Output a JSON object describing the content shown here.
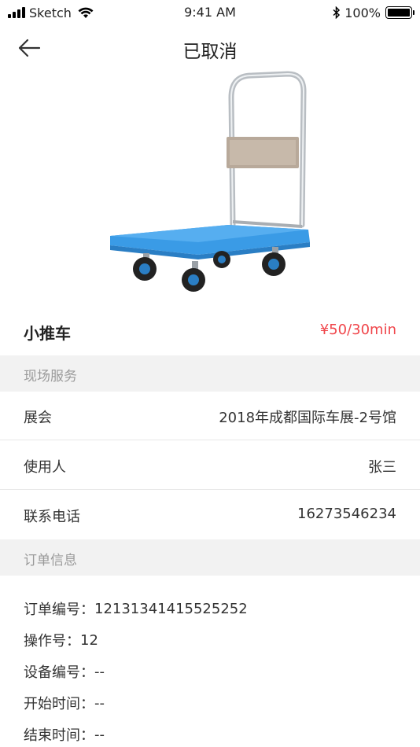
{
  "status_bar": {
    "carrier": "Sketch",
    "time": "9:41 AM",
    "battery": "100%"
  },
  "nav": {
    "title": "已取消"
  },
  "product": {
    "name": "小推车",
    "price": "¥50/30min"
  },
  "section_service": {
    "title": "现场服务",
    "rows": [
      {
        "label": "展会",
        "value": "2018年成都国际车展-2号馆"
      },
      {
        "label": "使用人",
        "value": "张三"
      },
      {
        "label": "联系电话",
        "value": "16273546234"
      }
    ]
  },
  "section_order": {
    "title": "订单信息",
    "items": [
      {
        "label": "订单编号：",
        "value": "12131341415525252"
      },
      {
        "label": "操作号：",
        "value": "12"
      },
      {
        "label": "设备编号：",
        "value": "--"
      },
      {
        "label": "开始时间：",
        "value": "--"
      },
      {
        "label": "结束时间：",
        "value": "--"
      }
    ]
  },
  "colors": {
    "price": "#f0464b",
    "section_bg": "#f2f2f2",
    "cart_blue": "#3a9be6"
  }
}
